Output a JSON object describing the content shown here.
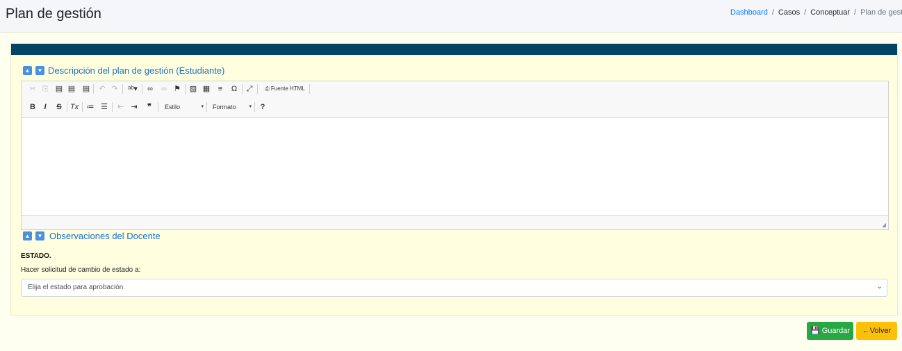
{
  "header": {
    "title": "Plan de gestión"
  },
  "breadcrumb": {
    "items": [
      "Dashboard",
      "Casos",
      "Conceptuar",
      "Plan de gestión"
    ]
  },
  "section1": {
    "title": "Descripción del plan de gestión (Estudiante)"
  },
  "editor": {
    "source_label": "Fuente HTML",
    "style_combo": "Estilo",
    "format_combo": "Formato",
    "content": ""
  },
  "section2": {
    "title": "Observaciones del Docente"
  },
  "estado": {
    "label": "ESTADO.",
    "sublabel": "Hacer solicitud de cambio de estado a:",
    "select_value": "Elija el estado para aprobación"
  },
  "buttons": {
    "save": "Guardar",
    "back": "Volver"
  },
  "colors": {
    "card_bar": "#004566",
    "link": "#007bff",
    "save": "#28a745",
    "back": "#ffc107",
    "panel": "#ffffe0"
  }
}
